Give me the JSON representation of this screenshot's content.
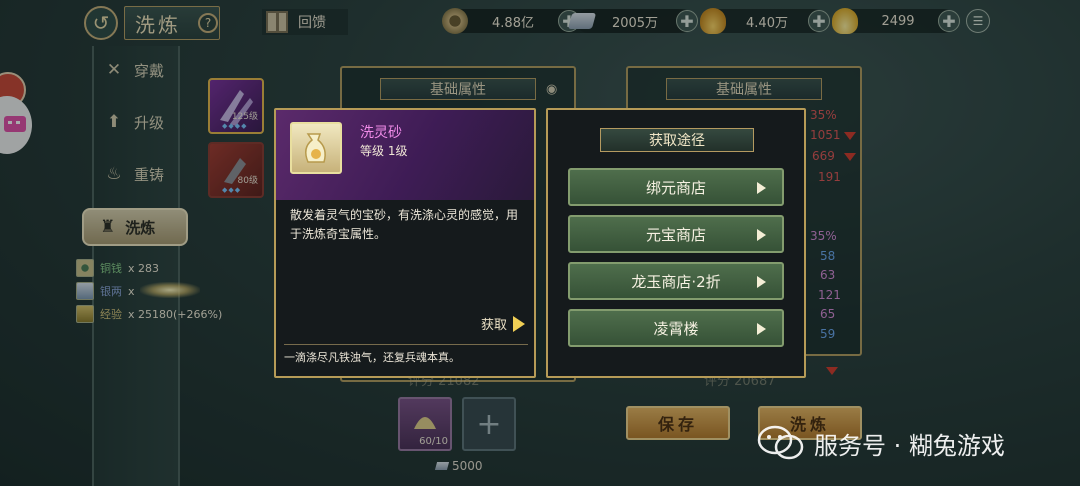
{
  "header": {
    "title": "洗炼",
    "help_label": "?",
    "gift_label": "回馈",
    "resources": [
      {
        "name": "coin-icon",
        "value": "4.88亿",
        "color": "#8c7a4a"
      },
      {
        "name": "silver-bar-icon",
        "value": "2005万",
        "color": "#a8b8c8"
      },
      {
        "name": "gold-ingot-icon",
        "value": "4.40万",
        "color": "#e6b34a"
      },
      {
        "name": "yuanbao-icon",
        "value": "2499",
        "color": "#f2c94c"
      }
    ]
  },
  "sidebar": {
    "items": [
      {
        "label": "穿戴",
        "icon": "sword-cross-icon"
      },
      {
        "label": "升级",
        "icon": "arrow-up-icon"
      },
      {
        "label": "重铸",
        "icon": "flame-icon"
      },
      {
        "label": "洗炼",
        "icon": "cauldron-icon"
      }
    ],
    "materials": [
      {
        "label": "铜钱",
        "amount": "x 283"
      },
      {
        "label": "银两",
        "amount": "x"
      },
      {
        "label": "经验",
        "amount": "x 25180(+266%)"
      }
    ]
  },
  "equipment": [
    {
      "level": "125级",
      "color": "#8a3ab0"
    },
    {
      "level": "80级",
      "color": "#a53b32"
    }
  ],
  "panels": {
    "left_tab": "基础属性",
    "right_tab": "基础属性",
    "right_stats": [
      {
        "value": "35%",
        "color": "#e05555"
      },
      {
        "value": "1051",
        "color": "#e05555"
      },
      {
        "value": "669",
        "color": "#e05555"
      },
      {
        "value": "191",
        "color": "#e05555"
      },
      {
        "value": "35%",
        "color": "#d68ad8"
      },
      {
        "value": "58",
        "color": "#6aa6f0"
      },
      {
        "value": "63",
        "color": "#d68ad8"
      },
      {
        "value": "121",
        "color": "#d68ad8"
      },
      {
        "value": "65",
        "color": "#d68ad8"
      },
      {
        "value": "59",
        "color": "#6aa6f0"
      }
    ],
    "left_score": "评分 21082",
    "right_score": "评分 20687"
  },
  "item_popup": {
    "name": "洗灵砂",
    "level": "等级  1级",
    "description": "散发着灵气的宝砂，有洗涤心灵的感觉，用于洗炼奇宝属性。",
    "acquire_label": "获取",
    "flavor": "一滴涤尽凡铁浊气，还复兵魂本真。"
  },
  "source_popup": {
    "title": "获取途径",
    "sources": [
      "绑元商店",
      "元宝商店",
      "龙玉商店·2折",
      "凌霄楼"
    ]
  },
  "bottom": {
    "material_count": "60/10",
    "add_symbol": "+",
    "cost": "5000",
    "save_label": "保存",
    "refine_label": "洗炼"
  },
  "watermark": "服务号 · 糊兔游戏"
}
